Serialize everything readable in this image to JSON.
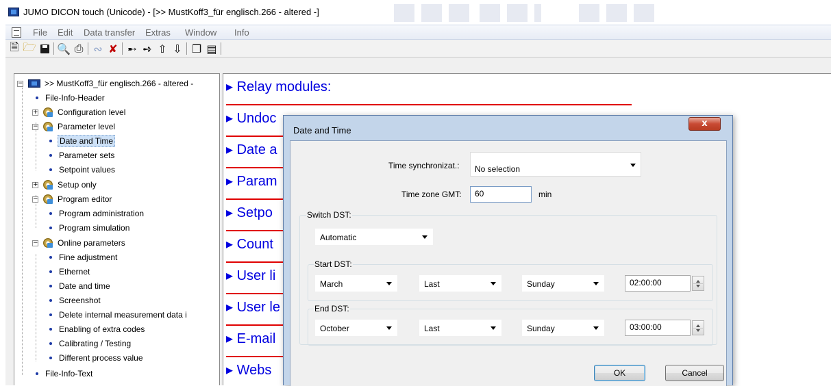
{
  "window": {
    "title": "JUMO DICON touch (Unicode) - [>> MustKoff3_für englisch.266 - altered -]"
  },
  "menu": [
    "File",
    "Edit",
    "Data transfer",
    "Extras",
    "Window",
    "Info"
  ],
  "toolbar": {
    "buttons": [
      "new-file-icon",
      "open-folder-icon",
      "save-icon",
      "print-preview-icon",
      "print-icon",
      "connection-icon",
      "disconnect-icon",
      "transfer-to-device-icon",
      "transfer-from-device-icon",
      "upload-icon",
      "download-icon",
      "window-cascade-icon",
      "window-tile-icon"
    ]
  },
  "tree": {
    "root": ">> MustKoff3_für englisch.266 - altered -",
    "items": [
      {
        "label": "File-Info-Header"
      },
      {
        "label": "Configuration level"
      },
      {
        "label": "Parameter level"
      },
      {
        "label": "Date and Time"
      },
      {
        "label": "Parameter sets"
      },
      {
        "label": "Setpoint values"
      },
      {
        "label": "Setup only"
      },
      {
        "label": "Program editor"
      },
      {
        "label": "Program administration"
      },
      {
        "label": "Program simulation"
      },
      {
        "label": "Online parameters"
      },
      {
        "label": "Fine adjustment"
      },
      {
        "label": "Ethernet"
      },
      {
        "label": "Date and time"
      },
      {
        "label": "Screenshot"
      },
      {
        "label": "Delete internal measurement data i"
      },
      {
        "label": "Enabling of extra codes"
      },
      {
        "label": "Calibrating / Testing"
      },
      {
        "label": "Different process value"
      },
      {
        "label": "File-Info-Text"
      }
    ],
    "selected": "Date and Time"
  },
  "content": {
    "sections": [
      "Relay modules:",
      "Undoc",
      "Date a",
      "Param",
      "Setpo",
      "Count",
      "User li",
      "User le",
      "E-mail",
      "Webs"
    ]
  },
  "dialog": {
    "title": "Date and Time",
    "close": "x",
    "time_sync_label": "Time synchronizat.:",
    "time_sync_value": "No selection",
    "tz_label": "Time zone GMT:",
    "tz_value": "60",
    "tz_unit": "min",
    "switch_dst_label": "Switch DST:",
    "switch_dst_value": "Automatic",
    "start_dst": {
      "label": "Start DST:",
      "month": "March",
      "week": "Last",
      "day": "Sunday",
      "time": "02:00:00"
    },
    "end_dst": {
      "label": "End DST:",
      "month": "October",
      "week": "Last",
      "day": "Sunday",
      "time": "03:00:00"
    },
    "ok": "OK",
    "cancel": "Cancel"
  }
}
